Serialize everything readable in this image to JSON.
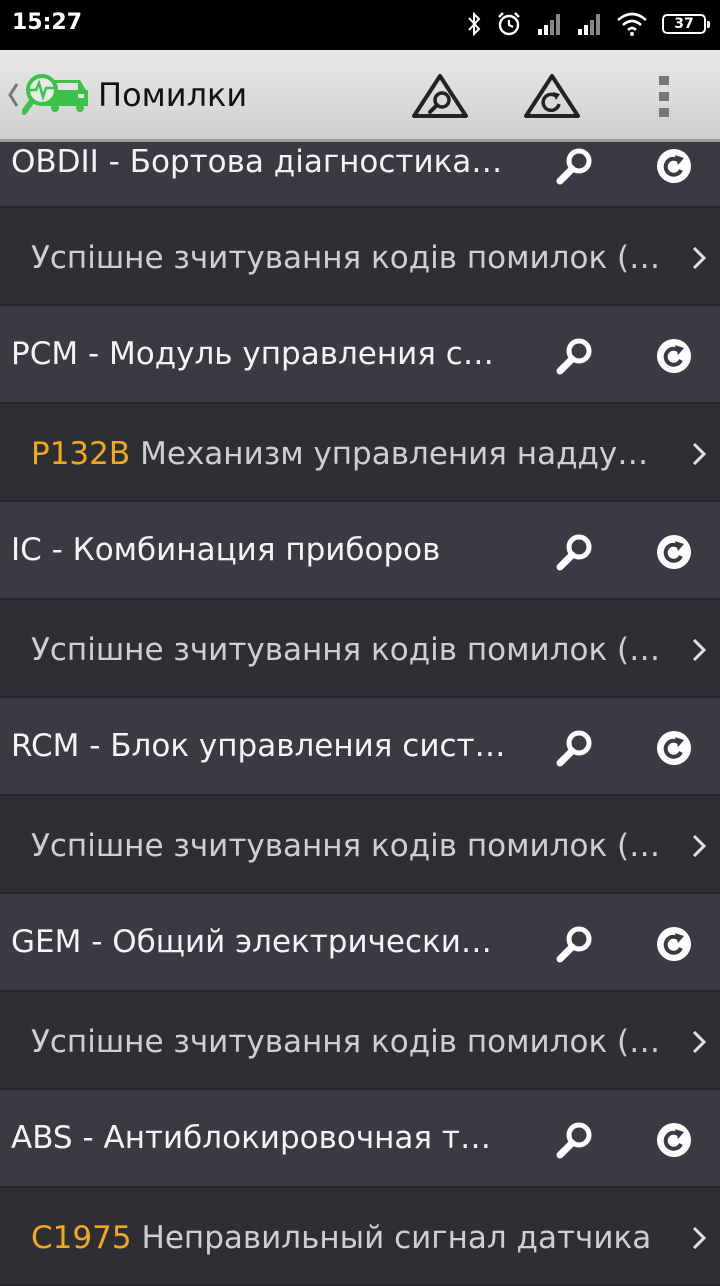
{
  "status_bar": {
    "time": "15:27",
    "battery": "37",
    "icons": [
      "bluetooth-icon",
      "alarm-icon",
      "signal-icon",
      "signal-icon",
      "wifi-icon",
      "battery-icon"
    ]
  },
  "action_bar": {
    "title": "Помилки",
    "actions": [
      "search-icon",
      "refresh-icon",
      "overflow-menu-icon"
    ]
  },
  "colors": {
    "code": "#f3a81c",
    "module_bg": "#3a3b42",
    "error_bg": "#2e2f35",
    "logo_green": "#3cc24b"
  },
  "modules": [
    {
      "name": "OBDII - Бортова діагностика…",
      "message": {
        "code": "",
        "text": "Успішне зчитування кодів помилок (…"
      }
    },
    {
      "name": "PCM - Модуль управления с…",
      "message": {
        "code": "P132B",
        "text": "Механизм управления надду…"
      }
    },
    {
      "name": "IC - Комбинация приборов",
      "message": {
        "code": "",
        "text": "Успішне зчитування кодів помилок (…"
      }
    },
    {
      "name": "RCM - Блок управления сист…",
      "message": {
        "code": "",
        "text": "Успішне зчитування кодів помилок (…"
      }
    },
    {
      "name": "GEM - Общий электрически…",
      "message": {
        "code": "",
        "text": "Успішне зчитування кодів помилок (…"
      }
    },
    {
      "name": "ABS - Антиблокировочная т…",
      "message": {
        "code": "C1975",
        "text": "Неправильный сигнал датчика"
      }
    }
  ]
}
